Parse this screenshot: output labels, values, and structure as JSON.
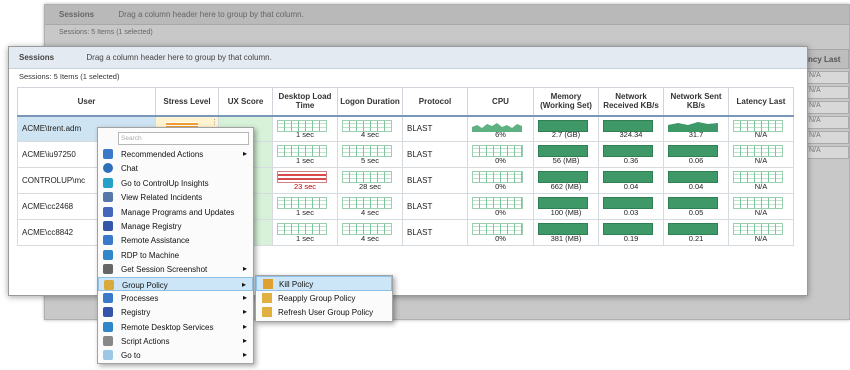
{
  "bg_window": {
    "title": "Sessions",
    "hint": "Drag a column header here to group by that column.",
    "sub": "Sessions: 5 Items (1 selected)",
    "right_col_header": "ncy Last",
    "right_cells": [
      "N/A",
      "N/A",
      "N/A",
      "N/A",
      "N/A",
      "N/A"
    ]
  },
  "grouping_bar": {
    "title": "Sessions",
    "hint": "Drag a column header here to group by that column."
  },
  "session_count": "Sessions: 5 Items (1 selected)",
  "columns": [
    "User",
    "Stress Level",
    "UX Score",
    "Desktop Load Time",
    "Logon Duration",
    "Protocol",
    "CPU",
    "Memory (Working Set)",
    "Network Received KB/s",
    "Network Sent KB/s",
    "Latency Last"
  ],
  "rows": [
    {
      "user": "ACME\\trent.adm",
      "desktop": "1 sec",
      "logon": "4 sec",
      "protocol": "BLAST",
      "cpu": "6%",
      "memory": "2.7 (GB)",
      "net_rx": "324.34",
      "net_tx": "31.7",
      "latency": "N/A"
    },
    {
      "user": "ACME\\iu97250",
      "desktop": "1 sec",
      "logon": "5 sec",
      "protocol": "BLAST",
      "cpu": "0%",
      "memory": "56 (MB)",
      "net_rx": "0.36",
      "net_tx": "0.06",
      "latency": "N/A"
    },
    {
      "user": "CONTROLUP\\mc",
      "desktop": "23 sec",
      "logon": "28 sec",
      "protocol": "BLAST",
      "cpu": "0%",
      "memory": "662 (MB)",
      "net_rx": "0.04",
      "net_tx": "0.04",
      "latency": "N/A"
    },
    {
      "user": "ACME\\cc2468",
      "desktop": "1 sec",
      "logon": "4 sec",
      "protocol": "BLAST",
      "cpu": "0%",
      "memory": "100 (MB)",
      "net_rx": "0.03",
      "net_tx": "0.05",
      "latency": "N/A"
    },
    {
      "user": "ACME\\cc8842",
      "desktop": "1 sec",
      "logon": "4 sec",
      "protocol": "BLAST",
      "cpu": "0%",
      "memory": "381 (MB)",
      "net_rx": "0.19",
      "net_tx": "0.21",
      "latency": "N/A"
    }
  ],
  "context_menu": {
    "search_placeholder": "Search",
    "items": [
      {
        "label": "Recommended Actions",
        "icon": "star-icon",
        "submenu": true
      },
      {
        "label": "Chat",
        "icon": "chat-icon",
        "submenu": false
      },
      {
        "label": "Go to ControlUp Insights",
        "icon": "insights-icon",
        "submenu": false
      },
      {
        "label": "View Related Incidents",
        "icon": "incidents-icon",
        "submenu": false
      },
      {
        "label": "Manage Programs and Updates",
        "icon": "programs-icon",
        "submenu": false
      },
      {
        "label": "Manage Registry",
        "icon": "registry-icon",
        "submenu": false
      },
      {
        "label": "Remote Assistance",
        "icon": "assistance-icon",
        "submenu": false
      },
      {
        "label": "RDP to Machine",
        "icon": "rdp-icon",
        "submenu": false
      },
      {
        "label": "Get Session Screenshot",
        "icon": "camera-icon",
        "submenu": true
      },
      {
        "label": "Group Policy",
        "icon": "policy-icon",
        "submenu": true
      },
      {
        "label": "Processes",
        "icon": "processes-icon",
        "submenu": true
      },
      {
        "label": "Registry",
        "icon": "registry-icon",
        "submenu": true
      },
      {
        "label": "Remote Desktop Services",
        "icon": "rds-icon",
        "submenu": true
      },
      {
        "label": "Script Actions",
        "icon": "script-icon",
        "submenu": true
      },
      {
        "label": "Go to",
        "icon": "goto-icon",
        "submenu": true
      }
    ]
  },
  "sub_menu": {
    "items": [
      {
        "label": "Kill Policy",
        "icon": "kill-policy-icon"
      },
      {
        "label": "Reapply Group Policy",
        "icon": "reapply-policy-icon"
      },
      {
        "label": "Refresh User Group Policy",
        "icon": "refresh-policy-icon"
      }
    ]
  }
}
